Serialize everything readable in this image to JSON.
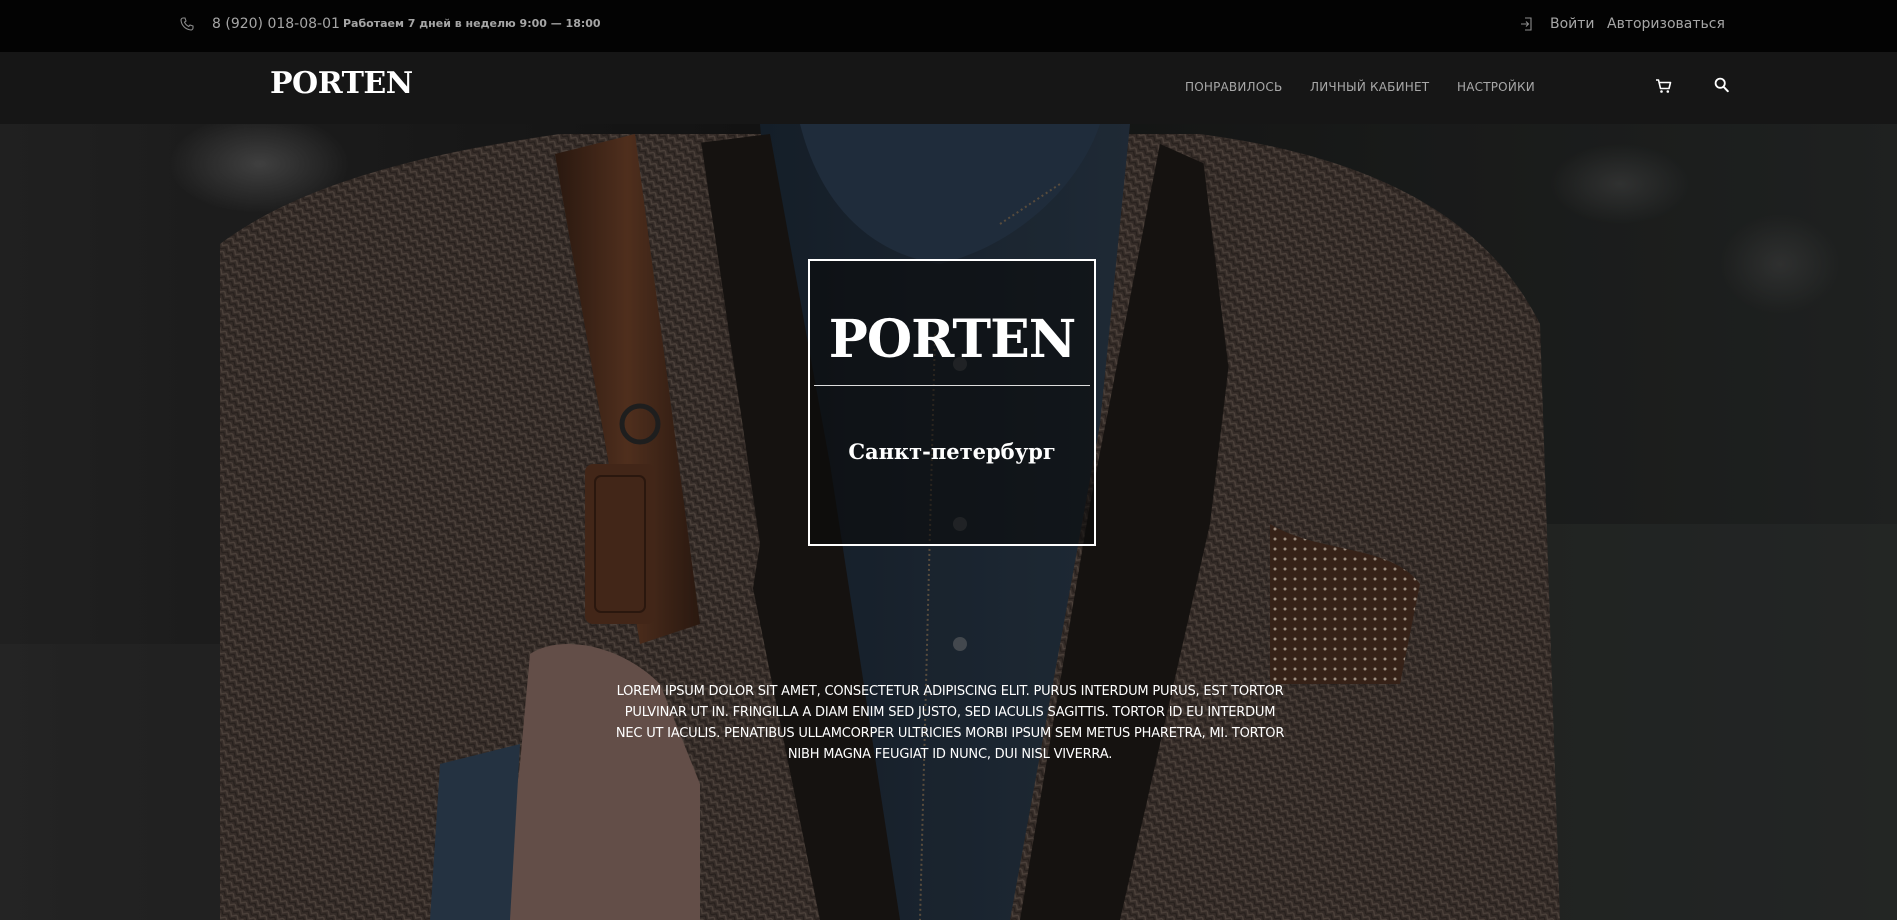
{
  "topbar": {
    "phone": "8 (920) 018-08-01",
    "hours": "Работаем 7 дней в неделю 9:00 — 18:00",
    "login": "Войти",
    "auth": "Авторизоваться"
  },
  "navbar": {
    "logo": "PORTEN",
    "items": [
      "Понравилось",
      "Личный кабинет",
      "Настройки"
    ]
  },
  "hero": {
    "title": "PORTEN",
    "city": "Санкт-петербург",
    "text": "Lorem ipsum dolor sit amet, consectetur adipiscing elit. Purus interdum purus, est tortor pulvinar ut in. Fringilla a diam enim sed justo, sed iaculis sagittis. Tortor id eu interdum nec ut iaculis. Penatibus ullamcorper ultricies morbi ipsum sem metus pharetra, mi. Tortor nibh magna feugiat id nunc, dui nisl viverra."
  },
  "icons": [
    "phone-icon",
    "login-icon",
    "cart-icon",
    "search-icon"
  ],
  "colors": {
    "topbar_bg": "#030303",
    "navbar_bg": "#161616",
    "text_muted": "#a8a8a8",
    "accent": "#ffffff"
  }
}
